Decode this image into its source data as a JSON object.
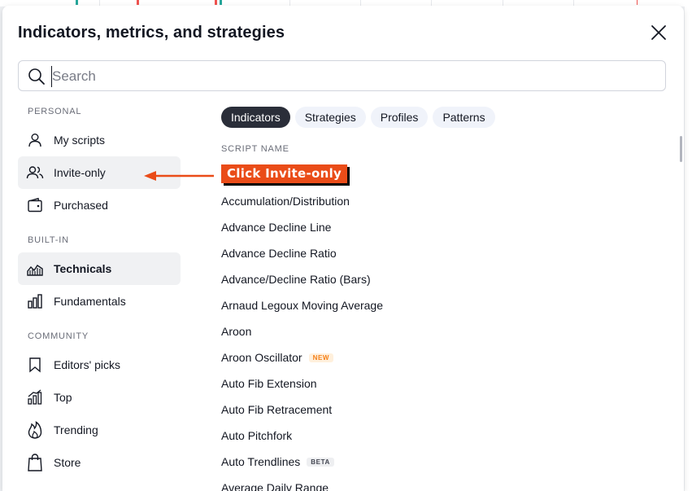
{
  "dialog": {
    "title": "Indicators, metrics, and strategies",
    "search_placeholder": "Search",
    "search_value": ""
  },
  "sidebar": {
    "sections": [
      {
        "label": "PERSONAL",
        "items": [
          {
            "label": "My scripts",
            "icon": "user-icon"
          },
          {
            "label": "Invite-only",
            "icon": "users-icon"
          },
          {
            "label": "Purchased",
            "icon": "wallet-icon"
          }
        ]
      },
      {
        "label": "BUILT-IN",
        "items": [
          {
            "label": "Technicals",
            "icon": "chart-area-icon"
          },
          {
            "label": "Fundamentals",
            "icon": "bar-chart-icon"
          }
        ]
      },
      {
        "label": "COMMUNITY",
        "items": [
          {
            "label": "Editors' picks",
            "icon": "bookmark-icon"
          },
          {
            "label": "Top",
            "icon": "top-chart-icon"
          },
          {
            "label": "Trending",
            "icon": "flame-icon"
          },
          {
            "label": "Store",
            "icon": "shopping-bag-icon"
          }
        ]
      }
    ],
    "active_item": "Technicals",
    "highlighted_item": "Invite-only"
  },
  "tabs": [
    {
      "label": "Indicators",
      "active": true
    },
    {
      "label": "Strategies",
      "active": false
    },
    {
      "label": "Profiles",
      "active": false
    },
    {
      "label": "Patterns",
      "active": false
    }
  ],
  "list": {
    "header": "SCRIPT NAME",
    "items": [
      {
        "name": "Accumulation/Distribution",
        "badge": ""
      },
      {
        "name": "Advance Decline Line",
        "badge": ""
      },
      {
        "name": "Advance Decline Ratio",
        "badge": ""
      },
      {
        "name": "Advance/Decline Ratio (Bars)",
        "badge": ""
      },
      {
        "name": "Arnaud Legoux Moving Average",
        "badge": ""
      },
      {
        "name": "Aroon",
        "badge": ""
      },
      {
        "name": "Aroon Oscillator",
        "badge": "NEW"
      },
      {
        "name": "Auto Fib Extension",
        "badge": ""
      },
      {
        "name": "Auto Fib Retracement",
        "badge": ""
      },
      {
        "name": "Auto Pitchfork",
        "badge": ""
      },
      {
        "name": "Auto Trendlines",
        "badge": "BETA"
      },
      {
        "name": "Average Daily Range",
        "badge": ""
      }
    ]
  },
  "annotation": {
    "label": "Click Invite-only",
    "color": "#ea4c18"
  },
  "colors": {
    "active_tab_bg": "#2a2e39",
    "hover_bg": "#f0f1f3",
    "text": "#131722",
    "muted": "#6a6d78"
  }
}
